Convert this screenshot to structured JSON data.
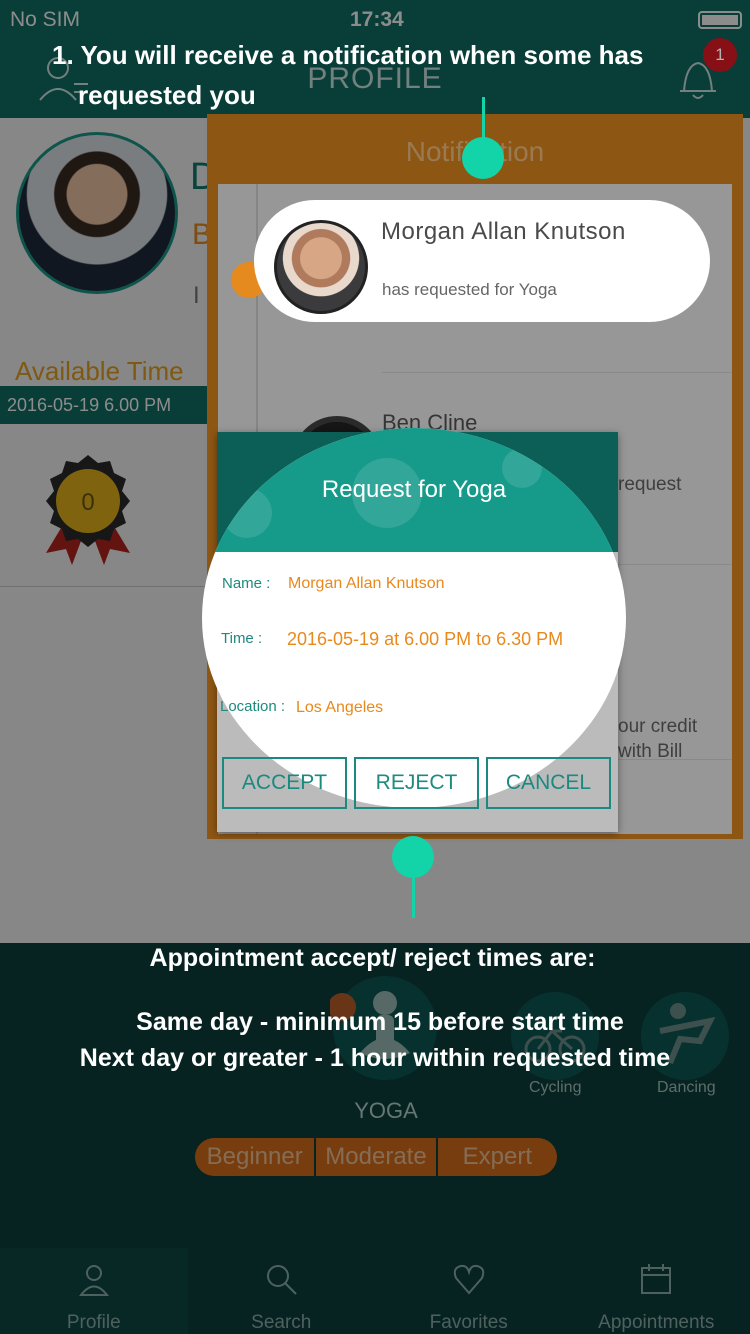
{
  "status": {
    "carrier": "No SIM",
    "time": "17:34"
  },
  "nav": {
    "title": "PROFILE",
    "badge_count": "1"
  },
  "profile": {
    "initial_name": "D",
    "initial_b": "B",
    "initial_i": "I",
    "available_label": "Available Time",
    "available_time": "2016-05-19 6.00 PM",
    "medal_count": "0"
  },
  "notifications": {
    "title": "Notification",
    "highlight": {
      "name": "Morgan Allan Knutson",
      "subtitle": "has requested for Yoga"
    },
    "second_name": "Ben Cline",
    "fragment_request": "request",
    "fragment_credit_1": "our credit",
    "fragment_credit_2": "with Bill"
  },
  "dialog": {
    "title": "Request for Yoga",
    "name_label": "Name :",
    "name_value": "Morgan Allan Knutson",
    "time_label": "Time :",
    "time_value": "2016-05-19 at 6.00 PM to 6.30 PM",
    "location_label": "Location :",
    "location_value": "Los Angeles",
    "accept": "ACCEPT",
    "reject": "REJECT",
    "cancel": "CANCEL"
  },
  "activities": {
    "selected": "YOGA",
    "cycling": "Cycling",
    "dancing": "Dancing",
    "levels": [
      "Beginner",
      "Moderate",
      "Expert"
    ]
  },
  "tabs": [
    "Profile",
    "Search",
    "Favorites",
    "Appointments"
  ],
  "captions": {
    "line1": "1. You will receive a notification when some has",
    "line2": "requested you",
    "line3": "Appointment accept/ reject times are:",
    "line4": "Same day - minimum 15 before start time",
    "line5": "Next day or greater - 1 hour within requested time"
  },
  "colors": {
    "teal": "#0f6f66",
    "accent_orange": "#e58a1f",
    "marker_green": "#13d3a8"
  }
}
